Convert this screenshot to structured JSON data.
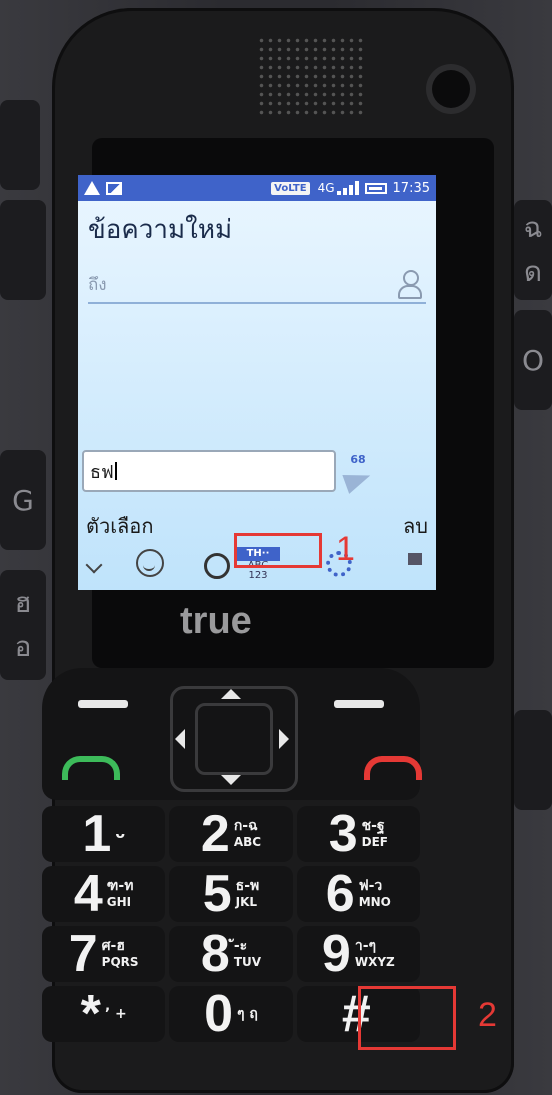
{
  "laptop_keys": [
    "G",
    "O",
    "ฉ",
    "ด",
    "ฮ",
    "อ"
  ],
  "status_bar": {
    "network": "VoLTE",
    "signal": "4G",
    "time": "17:35"
  },
  "app": {
    "title": "ข้อความใหม่",
    "to_placeholder": "ถึง"
  },
  "compose": {
    "text": "ธฟ",
    "char_count": "68"
  },
  "softkeys": {
    "left": "ตัวเลือก",
    "right": "ลบ"
  },
  "ime": {
    "lang": "TH··",
    "line2": "ABC",
    "line3": "123"
  },
  "brand": "true",
  "annotations": {
    "one": "1",
    "two": "2"
  },
  "keys": [
    {
      "num": "1",
      "l1": "ᴗ",
      "l2": ""
    },
    {
      "num": "2",
      "l1": "ก-ฉ",
      "l2": "ABC"
    },
    {
      "num": "3",
      "l1": "ช-ฐ",
      "l2": "DEF"
    },
    {
      "num": "4",
      "l1": "ฑ-ท",
      "l2": "GHI"
    },
    {
      "num": "5",
      "l1": "ธ-พ",
      "l2": "JKL"
    },
    {
      "num": "6",
      "l1": "ฟ-ว",
      "l2": "MNO"
    },
    {
      "num": "7",
      "l1": "ศ-ฮ",
      "l2": "PQRS"
    },
    {
      "num": "8",
      "l1": "ั-ะ",
      "l2": "TUV"
    },
    {
      "num": "9",
      "l1": "า-ๆ",
      "l2": "WXYZ"
    },
    {
      "num": "*",
      "l1": "’ +",
      "l2": ""
    },
    {
      "num": "0",
      "l1": "ๆ ฤ",
      "l2": ""
    },
    {
      "num": "#",
      "l1": "",
      "l2": ""
    }
  ],
  "colors": {
    "status_bar": "#3f63c9",
    "annotation": "#e53935",
    "call": "#3dbb5a",
    "end": "#e53935"
  }
}
